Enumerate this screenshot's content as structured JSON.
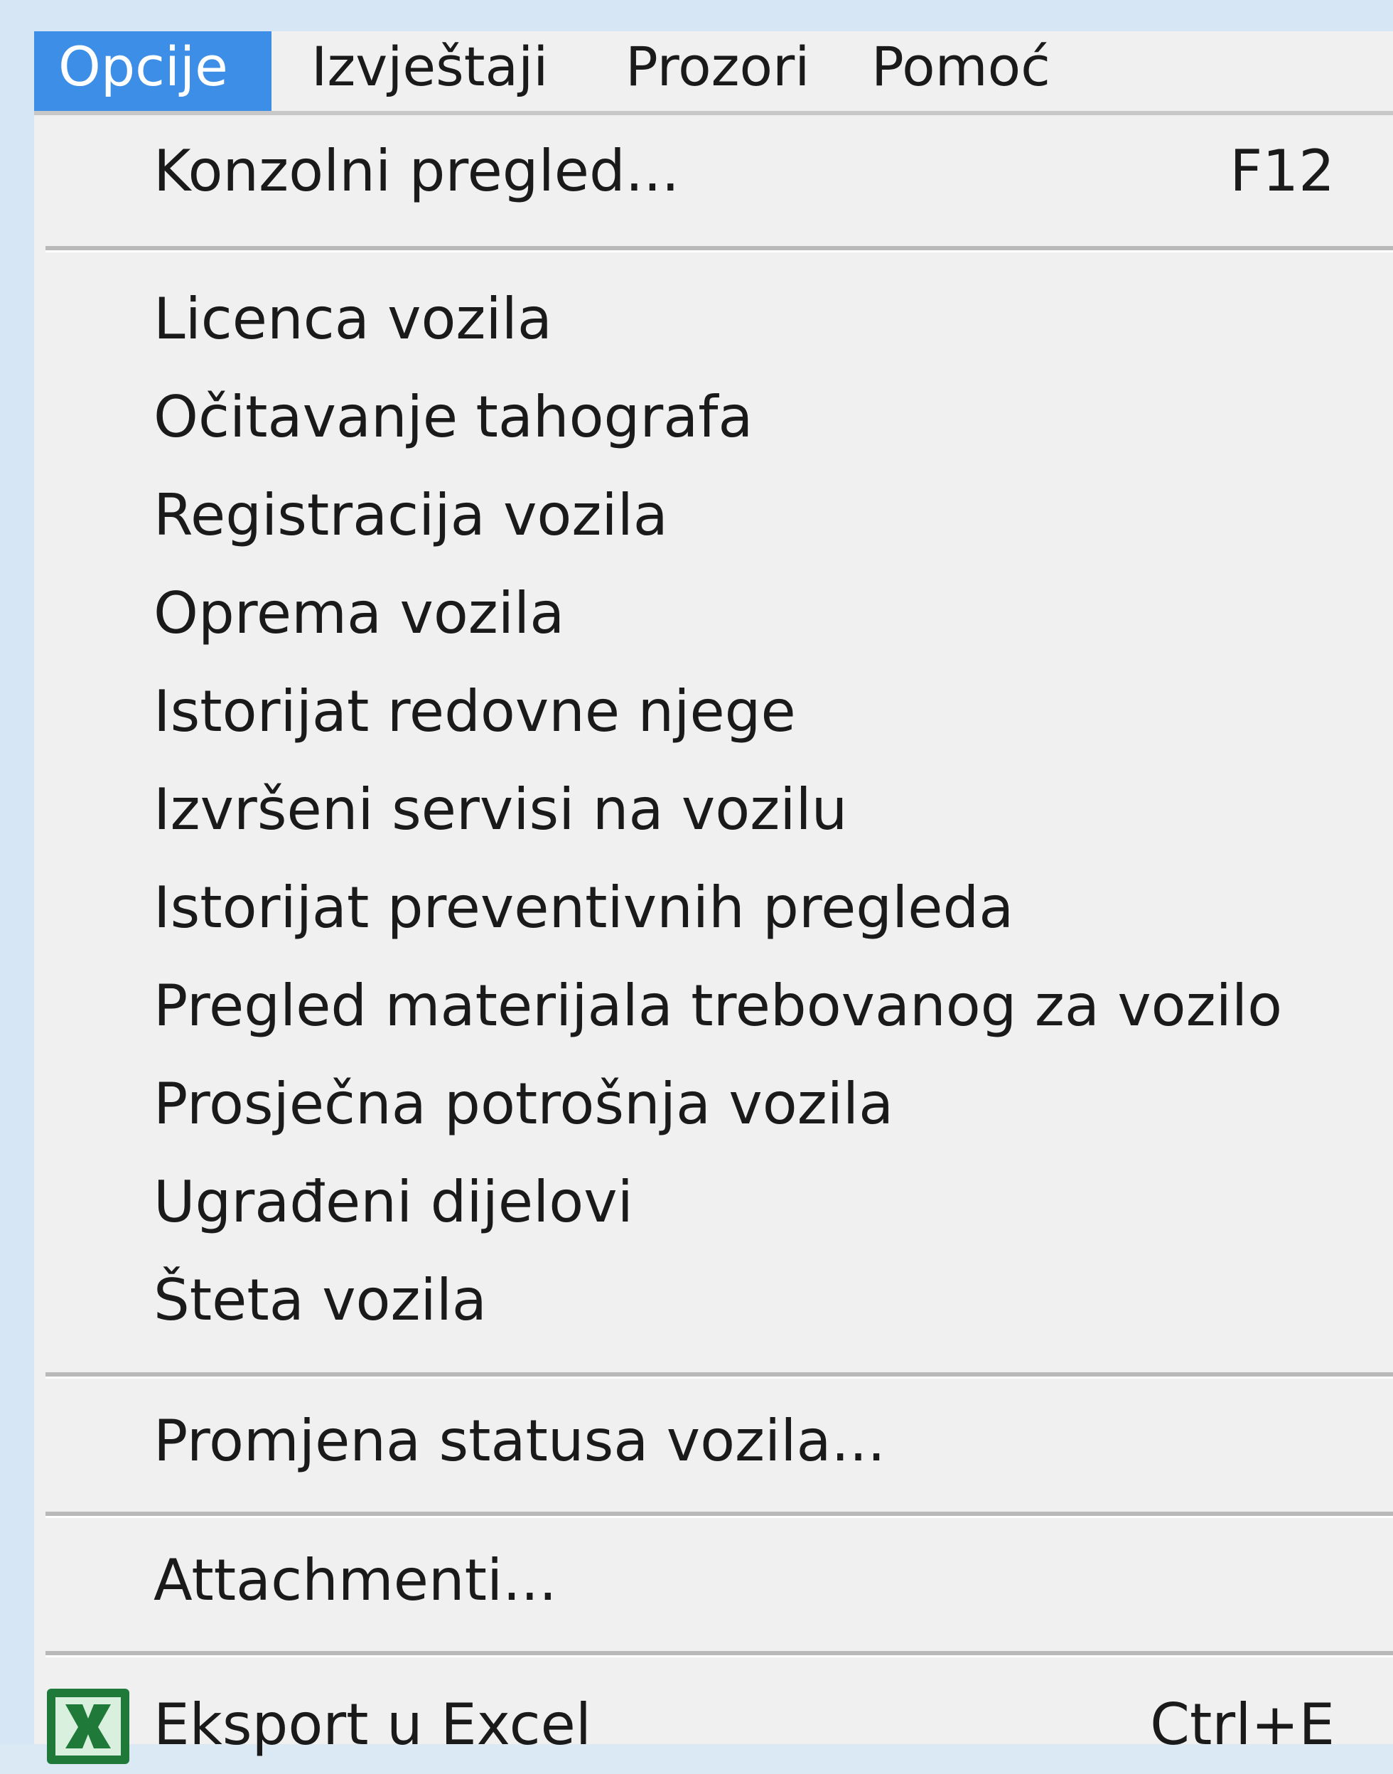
{
  "menubar": {
    "items": [
      {
        "label": "Opcije",
        "active": true
      },
      {
        "label": "Izvještaji",
        "active": false
      },
      {
        "label": "Prozori",
        "active": false
      },
      {
        "label": "Pomoć",
        "active": false
      }
    ]
  },
  "menu": {
    "konzolni": {
      "label": "Konzolni pregled...",
      "shortcut": "F12"
    },
    "items": [
      "Licenca vozila",
      "Očitavanje tahografa",
      "Registracija vozila",
      "Oprema vozila",
      "Istorijat redovne njege",
      "Izvršeni servisi na vozilu",
      "Istorijat preventivnih pregleda",
      "Pregled materijala trebovanog za vozilo",
      "Prosječna potrošnja vozila",
      "Ugrađeni dijelovi",
      "Šteta vozila"
    ],
    "promjena": {
      "label": "Promjena statusa vozila..."
    },
    "attachmenti": {
      "label": "Attachmenti..."
    },
    "eksport": {
      "label": "Eksport u Excel",
      "shortcut": "Ctrl+E",
      "icon": "excel-icon"
    }
  },
  "colors": {
    "active_menu": "#3d8ee6",
    "menu_bg": "#f0f0f0",
    "separator": "#b9b9b9",
    "excel_green": "#1f7a3a"
  }
}
